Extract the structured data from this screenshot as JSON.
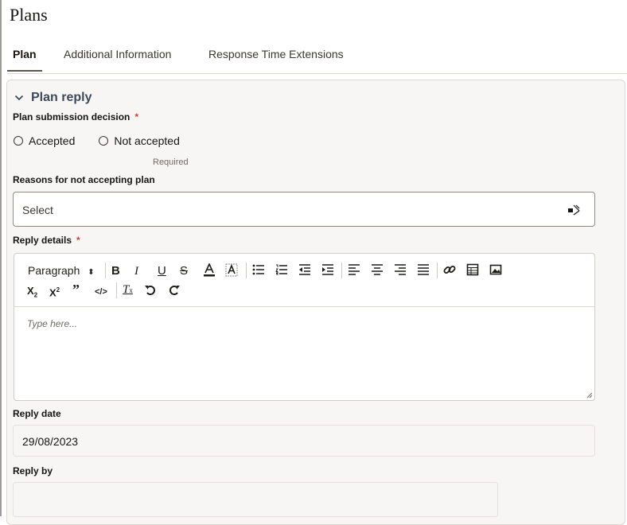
{
  "page": {
    "title": "Plans"
  },
  "tabs": [
    {
      "label": "Plan"
    },
    {
      "label": "Additional Information"
    },
    {
      "label": "Response Time Extensions"
    }
  ],
  "section": {
    "title": "Plan reply",
    "icon": "chevron-down-icon"
  },
  "decision": {
    "label": "Plan submission decision",
    "required_mark": "*",
    "options": [
      "Accepted",
      "Not accepted"
    ],
    "required_hint": "Required"
  },
  "reasons": {
    "label": "Reasons for not accepting plan",
    "value": "Select",
    "icon": "select-dropdown-icon"
  },
  "reply_details": {
    "label": "Reply details",
    "required_mark": "*",
    "block_format": "Paragraph",
    "placeholder": "Type here...",
    "toolbar_icons": [
      "bold",
      "italic",
      "underline",
      "strikethrough",
      "font-color",
      "highlight",
      "bulleted-list",
      "numbered-list",
      "outdent",
      "indent",
      "align-left",
      "align-center",
      "align-right",
      "justify",
      "link",
      "table",
      "image",
      "subscript",
      "superscript",
      "blockquote",
      "code",
      "remove-format",
      "undo",
      "redo"
    ]
  },
  "reply_date": {
    "label": "Reply date",
    "value": "29/08/2023"
  },
  "reply_by": {
    "label": "Reply by",
    "value": ""
  },
  "colors": {
    "required": "#c74634",
    "section_title": "#3d4a5c",
    "panel_bg": "#f7f6f4",
    "border": "#8e8a85"
  }
}
